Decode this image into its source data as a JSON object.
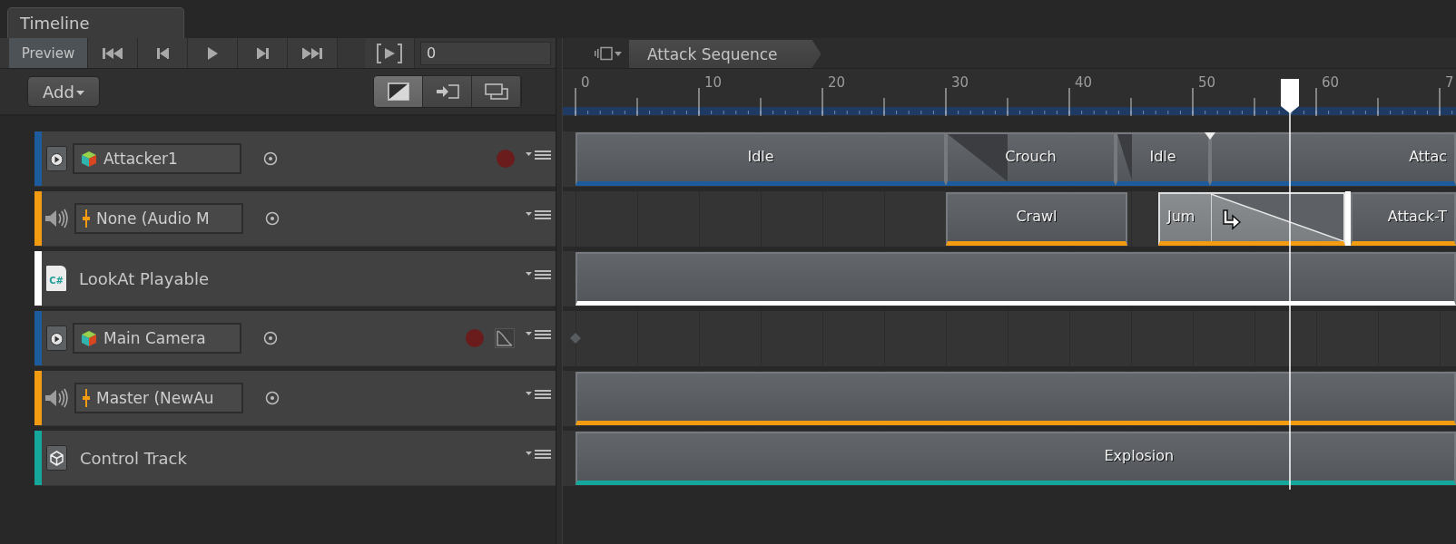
{
  "window": {
    "tab": "Timeline"
  },
  "toolbar": {
    "preview": {
      "label": "Preview",
      "on": true
    },
    "time": "0"
  },
  "add_button": {
    "label": "Add"
  },
  "edit_modes": [
    {
      "selected": true
    },
    {
      "selected": false
    },
    {
      "selected": false
    }
  ],
  "breadcrumb": [
    "Attack Sequence"
  ],
  "ruler": {
    "labels": [
      "0",
      "10",
      "20",
      "30",
      "40",
      "50",
      "60",
      "7"
    ]
  },
  "tracks": [
    {
      "kind": "animation",
      "color": "#1c5c9c",
      "field": "Attacker1",
      "record_armed": false,
      "clips": [
        {
          "label": "Idle",
          "selected": false,
          "blend_in": false,
          "blend_out": false
        },
        {
          "label": "Crouch",
          "selected": false,
          "blend_in": true,
          "blend_out": false
        },
        {
          "label": "Idle",
          "selected": false,
          "blend_in": true,
          "blend_out": false
        },
        {
          "label": "Attac",
          "selected": false,
          "blend_in": false,
          "blend_out": false
        }
      ]
    },
    {
      "kind": "audio",
      "color": "#f39c12",
      "field": "None (Audio M",
      "clips": [
        {
          "label": "Crawl",
          "selected": false,
          "blend_in": false,
          "blend_out": false
        },
        {
          "label": "Jum",
          "selected": true,
          "blend_in": false,
          "blend_out": true
        },
        {
          "label": "Attack-T",
          "selected": false,
          "blend_in": false,
          "blend_out": false
        }
      ]
    },
    {
      "kind": "playable",
      "color": "#ffffff",
      "name": "LookAt Playable",
      "icon_text": "C#",
      "clips": [
        {
          "selected": false,
          "blend_in": false,
          "blend_out": false
        }
      ]
    },
    {
      "kind": "animation",
      "color": "#1c5c9c",
      "field": "Main Camera",
      "record_armed": false,
      "curves_button": true,
      "key_marker": true
    },
    {
      "kind": "audio",
      "color": "#f39c12",
      "field": "Master (NewAu",
      "clips": [
        {
          "selected": false,
          "blend_in": false,
          "blend_out": false
        }
      ]
    },
    {
      "kind": "control",
      "color": "#15a79b",
      "name": "Control Track",
      "clips": [
        {
          "label": "Explosion",
          "selected": false,
          "blend_in": false,
          "blend_out": false
        }
      ]
    }
  ]
}
